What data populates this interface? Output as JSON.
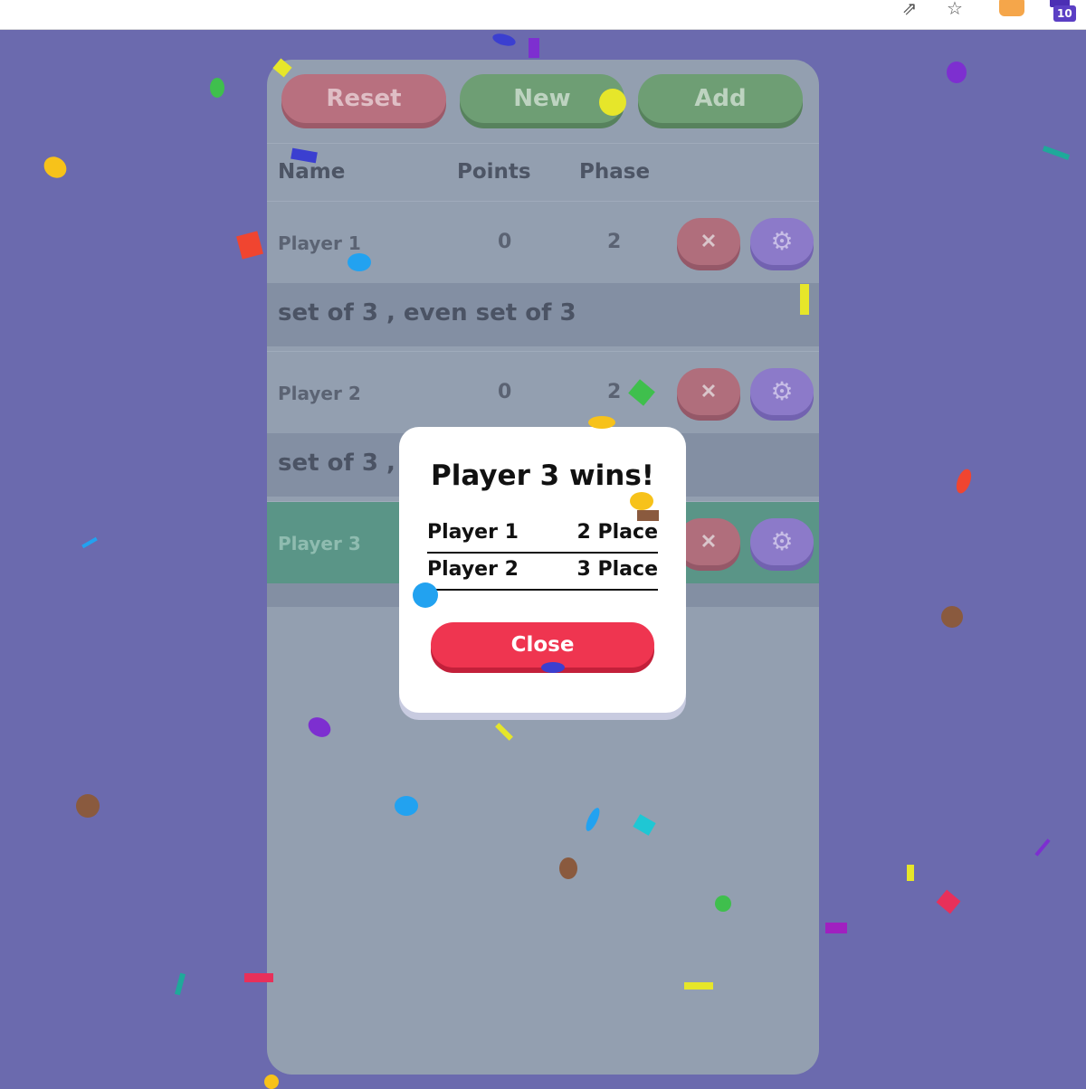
{
  "browser": {
    "extension_badge": "10"
  },
  "toolbar": {
    "reset_label": "Reset",
    "new_label": "New",
    "add_label": "Add"
  },
  "table": {
    "headers": {
      "name": "Name",
      "points": "Points",
      "phase": "Phase"
    },
    "players": [
      {
        "name": "Player 1",
        "points": "0",
        "phase": "2",
        "phase_desc": "set of 3 , even set of 3"
      },
      {
        "name": "Player 2",
        "points": "0",
        "phase": "2",
        "phase_desc": "set of 3 ,"
      },
      {
        "name": "Player 3",
        "active": true
      }
    ]
  },
  "modal": {
    "title": "Player 3 wins!",
    "rankings": [
      {
        "name": "Player 1",
        "place": "2 Place"
      },
      {
        "name": "Player 2",
        "place": "3 Place"
      }
    ],
    "close_label": "Close"
  },
  "icons": {
    "remove": "close-icon",
    "settings": "gear-icon"
  },
  "colors": {
    "background": "#6b6aae",
    "reset": "#b8707f",
    "new": "#6e9e74",
    "add": "#6e9e74",
    "active_row": "#5a9587",
    "close_button": "#ef3550"
  }
}
